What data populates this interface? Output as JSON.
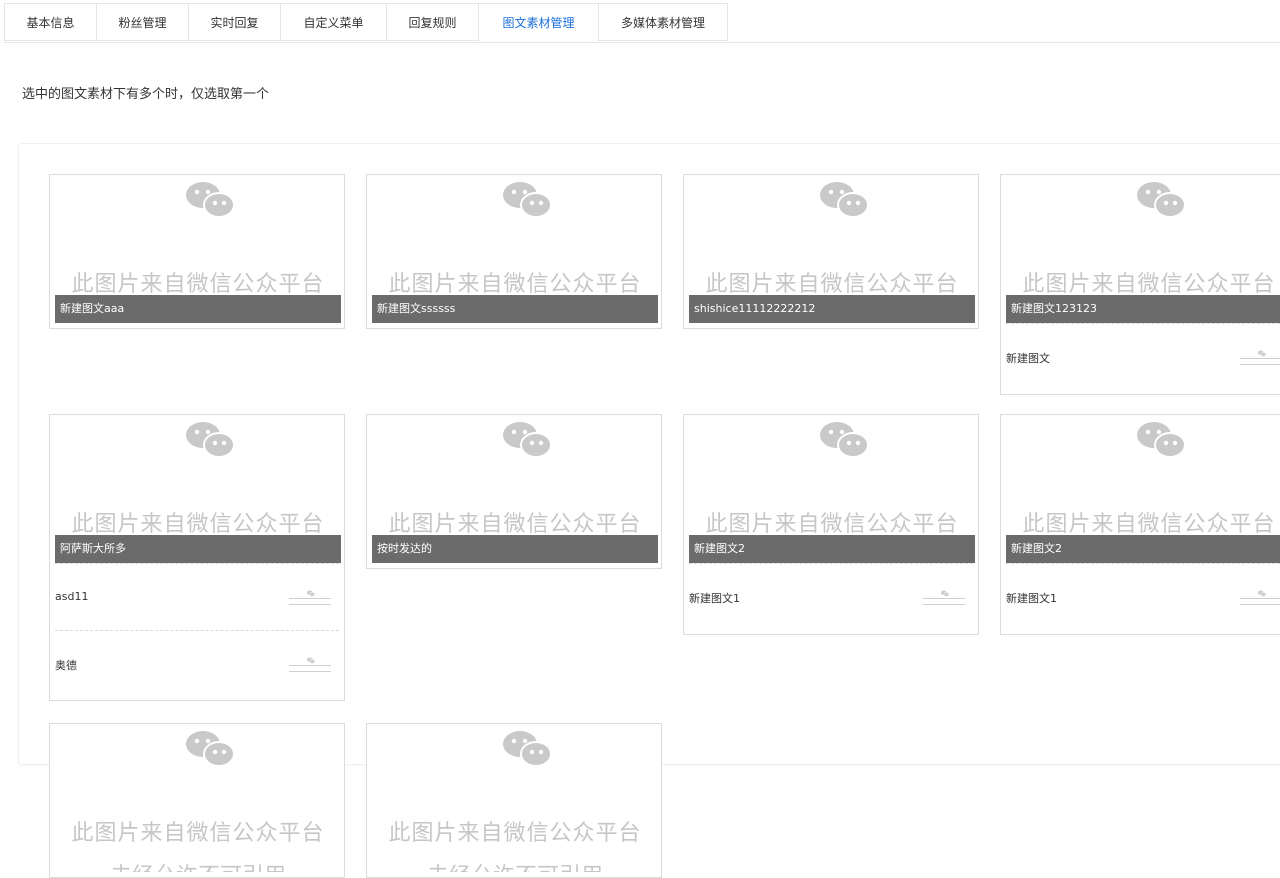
{
  "tabs": [
    {
      "label": "基本信息",
      "active": false
    },
    {
      "label": "粉丝管理",
      "active": false
    },
    {
      "label": "实时回复",
      "active": false
    },
    {
      "label": "自定义菜单",
      "active": false
    },
    {
      "label": "回复规则",
      "active": false
    },
    {
      "label": "图文素材管理",
      "active": true
    },
    {
      "label": "多媒体素材管理",
      "active": false
    }
  ],
  "notice": "选中的图文素材下有多个时，仅选取第一个",
  "watermark": {
    "line1": "此图片来自微信公众平台",
    "line2": "未经允许不可引用",
    "icon": "wechat-icon"
  },
  "colors": {
    "active_tab": "#1e6fd9",
    "caption_bg": "#6b6b6b"
  },
  "cards": [
    {
      "title": "新建图文aaa",
      "subs": []
    },
    {
      "title": "新建图文ssssss",
      "subs": []
    },
    {
      "title": "shishice11112222212",
      "subs": []
    },
    {
      "title": "新建图文123123",
      "subs": [
        "新建图文"
      ]
    },
    {
      "title": "阿萨斯大所多",
      "subs": [
        "asd11",
        "奥德"
      ]
    },
    {
      "title": "按时发达的",
      "subs": []
    },
    {
      "title": "新建图文2",
      "subs": [
        "新建图文1"
      ]
    },
    {
      "title": "新建图文2",
      "subs": [
        "新建图文1"
      ]
    },
    {
      "title": "",
      "subs": []
    },
    {
      "title": "",
      "subs": []
    }
  ]
}
